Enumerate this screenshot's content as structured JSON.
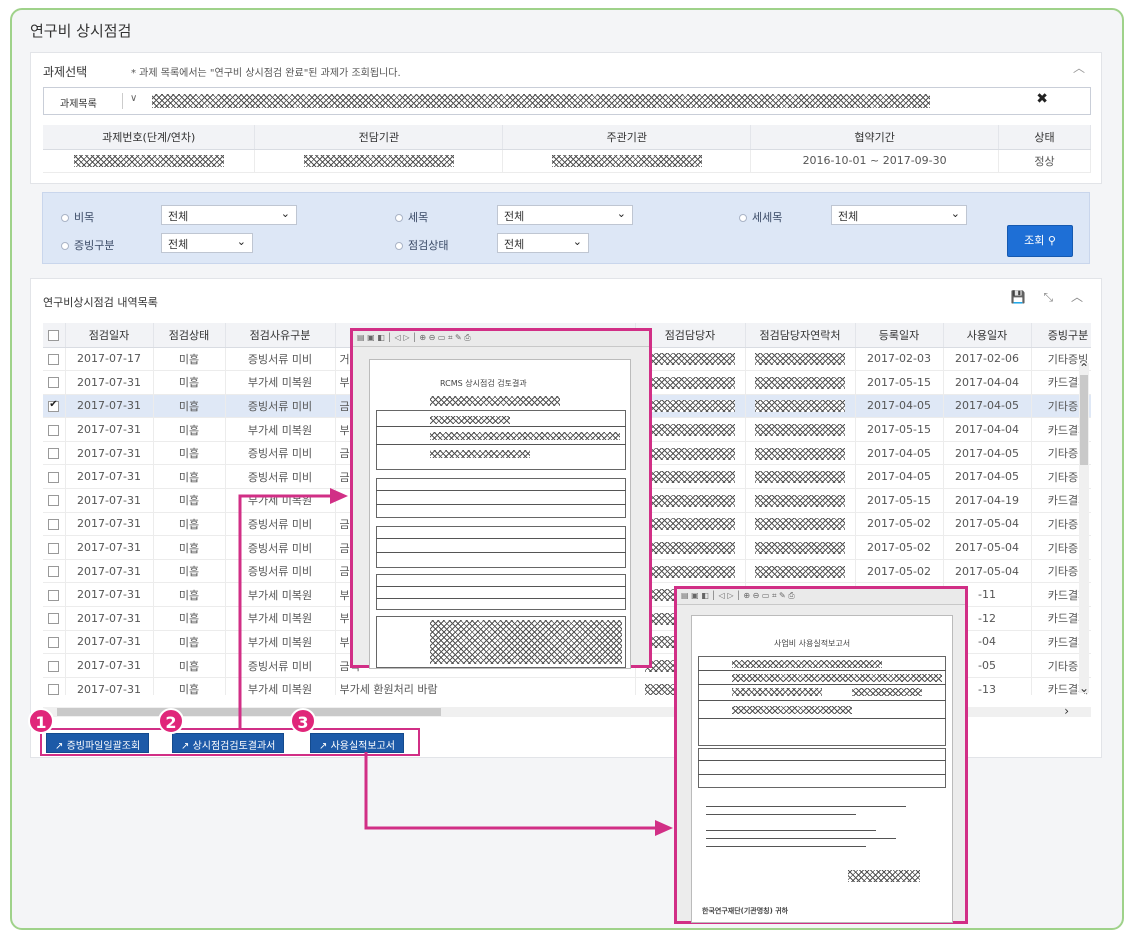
{
  "page": {
    "title": "연구비 상시점검"
  },
  "project_select": {
    "label": "과제선택",
    "note": "* 과제 목록에서는 \"연구비 상시점검 완료\"된 과제가 조회됩니다.",
    "dropdown_label": "과제목록",
    "headers": [
      "과제번호(단계/연차)",
      "전담기관",
      "주관기관",
      "협약기간",
      "상태"
    ],
    "row": {
      "period": "2016-10-01 ~ 2017-09-30",
      "status": "정상"
    }
  },
  "filters": {
    "item_label": "비목",
    "item_value": "전체",
    "subitem_label": "세목",
    "subitem_value": "전체",
    "detail_label": "세세목",
    "detail_value": "전체",
    "evidence_label": "증빙구분",
    "evidence_value": "전체",
    "status_label": "점검상태",
    "status_value": "전체",
    "search_button": "조회"
  },
  "list": {
    "title": "연구비상시점검 내역목록",
    "headers": [
      "점검일자",
      "점검상태",
      "점검사유구분",
      "점검담당자",
      "점검담당자연락처",
      "등록일자",
      "사용일자",
      "증빙구분"
    ],
    "rows": [
      {
        "date": "2017-07-17",
        "state": "미흡",
        "reason": "증빙서류 미비",
        "reason2": "거",
        "reg": "2017-02-03",
        "use": "2017-02-06",
        "ev": "기타증빙",
        "checked": false
      },
      {
        "date": "2017-07-31",
        "state": "미흡",
        "reason": "부가세 미복원",
        "reason2": "부",
        "reg": "2017-05-15",
        "use": "2017-04-04",
        "ev": "카드결제",
        "checked": false
      },
      {
        "date": "2017-07-31",
        "state": "미흡",
        "reason": "증빙서류 미비",
        "reason2": "금",
        "reg": "2017-04-05",
        "use": "2017-04-05",
        "ev": "기타증빙",
        "checked": true
      },
      {
        "date": "2017-07-31",
        "state": "미흡",
        "reason": "부가세 미복원",
        "reason2": "부",
        "reg": "2017-05-15",
        "use": "2017-04-04",
        "ev": "카드결제",
        "checked": false
      },
      {
        "date": "2017-07-31",
        "state": "미흡",
        "reason": "증빙서류 미비",
        "reason2": "금",
        "reg": "2017-04-05",
        "use": "2017-04-05",
        "ev": "기타증빙",
        "checked": false
      },
      {
        "date": "2017-07-31",
        "state": "미흡",
        "reason": "증빙서류 미비",
        "reason2": "금",
        "reg": "2017-04-05",
        "use": "2017-04-05",
        "ev": "기타증빙",
        "checked": false
      },
      {
        "date": "2017-07-31",
        "state": "미흡",
        "reason": "부가세 미복원",
        "reason2": "",
        "reg": "2017-05-15",
        "use": "2017-04-19",
        "ev": "카드결제",
        "checked": false
      },
      {
        "date": "2017-07-31",
        "state": "미흡",
        "reason": "증빙서류 미비",
        "reason2": "금",
        "reg": "2017-05-02",
        "use": "2017-05-04",
        "ev": "기타증빙",
        "checked": false
      },
      {
        "date": "2017-07-31",
        "state": "미흡",
        "reason": "증빙서류 미비",
        "reason2": "금",
        "reg": "2017-05-02",
        "use": "2017-05-04",
        "ev": "기타증빙",
        "checked": false
      },
      {
        "date": "2017-07-31",
        "state": "미흡",
        "reason": "증빙서류 미비",
        "reason2": "금",
        "reg": "2017-05-02",
        "use": "2017-05-04",
        "ev": "기타증빙",
        "checked": false
      },
      {
        "date": "2017-07-31",
        "state": "미흡",
        "reason": "부가세 미복원",
        "reason2": "부가",
        "reg": "",
        "use": "-11",
        "ev": "카드결제",
        "checked": false
      },
      {
        "date": "2017-07-31",
        "state": "미흡",
        "reason": "부가세 미복원",
        "reason2": "부",
        "reg": "",
        "use": "-12",
        "ev": "카드결제",
        "checked": false
      },
      {
        "date": "2017-07-31",
        "state": "미흡",
        "reason": "부가세 미복원",
        "reason2": "부",
        "reg": "",
        "use": "-04",
        "ev": "카드결제",
        "checked": false
      },
      {
        "date": "2017-07-31",
        "state": "미흡",
        "reason": "증빙서류 미비",
        "reason2": "금액",
        "reg": "",
        "use": "-05",
        "ev": "기타증빙",
        "checked": false
      },
      {
        "date": "2017-07-31",
        "state": "미흡",
        "reason": "부가세 미복원",
        "reason2": "부가세 환원처리 바람",
        "reg": "",
        "use": "-13",
        "ev": "카드결제",
        "checked": false
      }
    ]
  },
  "actions": [
    {
      "num": "1",
      "label": "증빙파일일괄조회"
    },
    {
      "num": "2",
      "label": "상시점검검토결과서"
    },
    {
      "num": "3",
      "label": "사용실적보고서"
    }
  ],
  "doc1": {
    "title": "RCMS 상시점검 검토결과"
  },
  "doc2": {
    "title": "사업비 사용실적보고서",
    "footer": "한국연구재단(기관명칭) 귀하"
  },
  "colors": {
    "accent": "#1d5aa8",
    "highlight": "#e0267a",
    "frame": "#9fd28a",
    "filter_bg": "#dde7f6"
  }
}
